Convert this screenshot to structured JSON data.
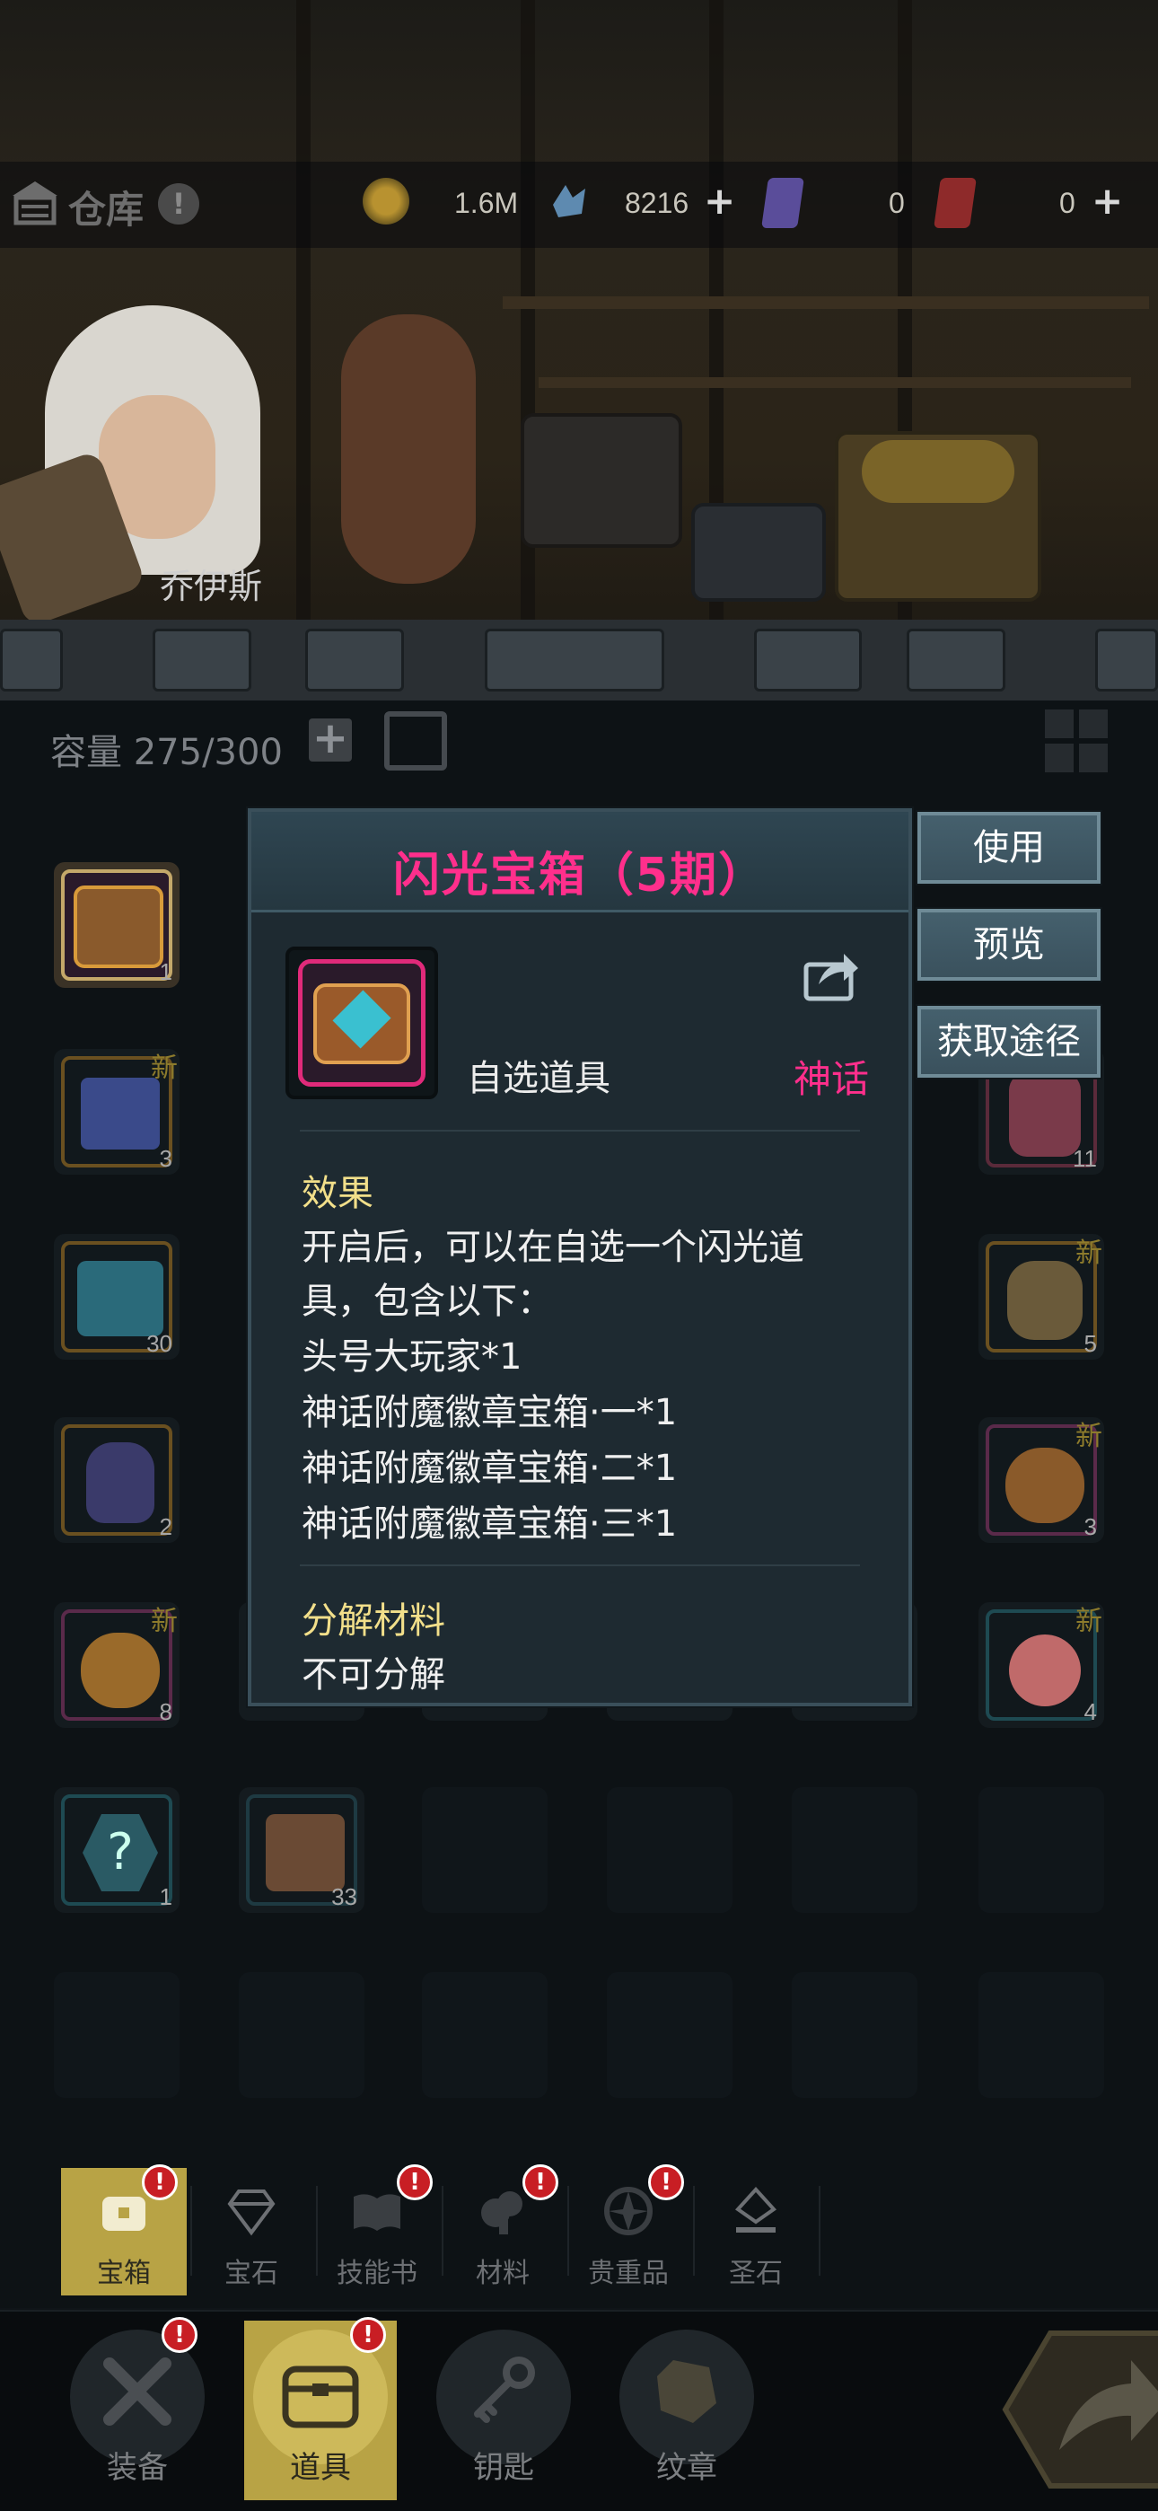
{
  "topbar": {
    "title": "仓库",
    "gold": "1.6M",
    "crystals": "8216",
    "card_a": "0",
    "card_b": "0"
  },
  "character": {
    "name": "乔伊斯"
  },
  "inventory": {
    "capacity_label": "容量",
    "capacity_value": "275/300",
    "new_label": "新",
    "counts": {
      "r0c0": "1",
      "r1c0": "3",
      "r1c5": "11",
      "r2c0": "30",
      "r2c5": "5",
      "r3c0": "2",
      "r3c5": "3",
      "r4c0": "8",
      "r4c5": "4",
      "r5c0": "1",
      "r5c1": "33"
    }
  },
  "popup": {
    "title": "闪光宝箱（5期）",
    "item_type": "自选道具",
    "rarity": "神话",
    "rarity_color": "#ff2f8c",
    "effect_title": "效果",
    "effect_lines": [
      "开启后，可以在自选一个闪光道",
      "具，包含以下：",
      "头号大玩家*1",
      "神话附魔徽章宝箱·一*1",
      "神话附魔徽章宝箱·二*1",
      "神话附魔徽章宝箱·三*1"
    ],
    "decompose_title": "分解材料",
    "decompose_value": "不可分解"
  },
  "actions": {
    "use": "使用",
    "preview": "预览",
    "obtain": "获取途径"
  },
  "categories": [
    {
      "label": "宝箱",
      "icon": "chest-icon",
      "badge": "!"
    },
    {
      "label": "宝石",
      "icon": "gem-icon",
      "badge": ""
    },
    {
      "label": "技能书",
      "icon": "book-icon",
      "badge": "!"
    },
    {
      "label": "材料",
      "icon": "material-icon",
      "badge": "!"
    },
    {
      "label": "贵重品",
      "icon": "valuable-icon",
      "badge": "!"
    },
    {
      "label": "圣石",
      "icon": "holy-stone-icon",
      "badge": ""
    }
  ],
  "nav": [
    {
      "label": "装备",
      "icon": "equipment-icon",
      "badge": "!"
    },
    {
      "label": "道具",
      "icon": "item-icon",
      "badge": "!"
    },
    {
      "label": "钥匙",
      "icon": "key-icon",
      "badge": ""
    },
    {
      "label": "纹章",
      "icon": "emblem-icon",
      "badge": ""
    }
  ],
  "colors": {
    "accent_gold": "#b8a345",
    "mythic_pink": "#ff2f8c",
    "badge_red": "#c81e24"
  }
}
